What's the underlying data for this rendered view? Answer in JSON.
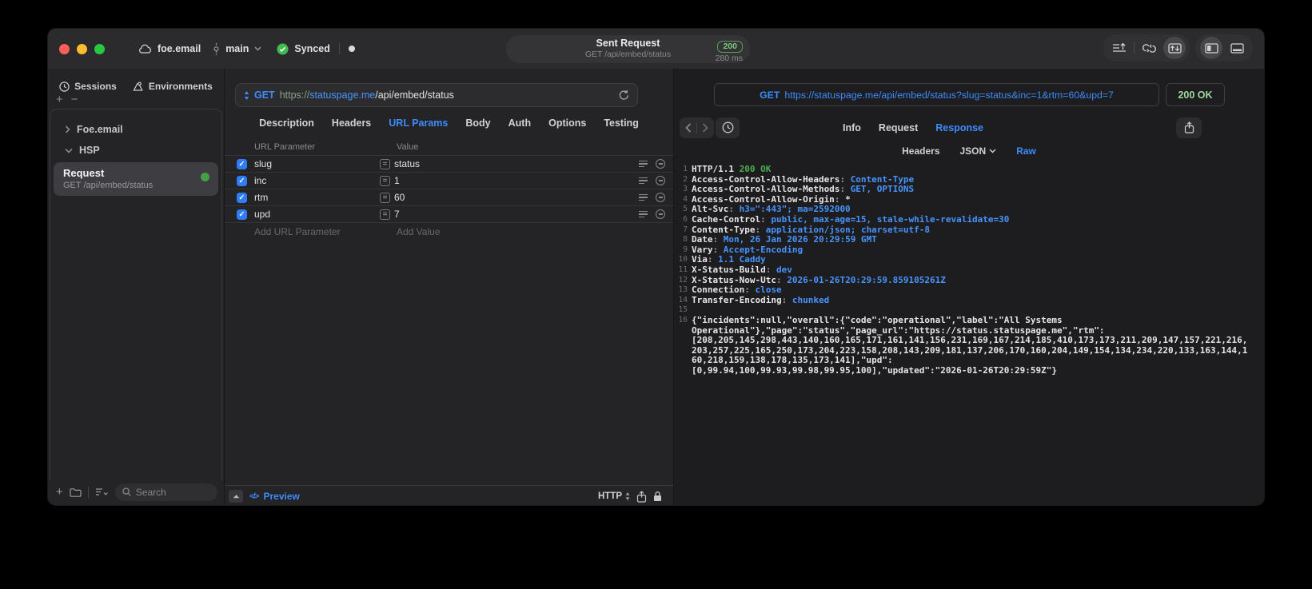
{
  "colors": {
    "accent_blue": "#3d8bfd",
    "url_host_blue": "#4794ff",
    "status_green": "#4cae50",
    "badge_green": "#7ec97e",
    "checkbox_blue": "#2f7cf6",
    "traffic_red": "#ff5f57",
    "traffic_yellow": "#febc2e",
    "traffic_green": "#28c840",
    "request_dot_green": "#43a047"
  },
  "titlebar": {
    "project": "foe.email",
    "branch": "main",
    "sync_status": "Synced",
    "request_title": "Sent Request",
    "request_subtitle": "GET /api/embed/status",
    "status_code": "200",
    "duration": "280 ms"
  },
  "sidebar": {
    "tabs": [
      {
        "label": "Sessions"
      },
      {
        "label": "Environments"
      }
    ],
    "add_label": "+",
    "remove_label": "−",
    "tree": [
      {
        "label": "Foe.email",
        "state": "collapsed"
      },
      {
        "label": "HSP",
        "state": "expanded"
      }
    ],
    "selected_request": {
      "name": "Request",
      "method_path": "GET /api/embed/status"
    },
    "search_placeholder": "Search"
  },
  "request_panel": {
    "method": "GET",
    "url_scheme": "https://",
    "url_host": "statuspage.me",
    "url_path": "/api/embed/status",
    "tabs": [
      "Description",
      "Headers",
      "URL Params",
      "Body",
      "Auth",
      "Options",
      "Testing"
    ],
    "active_tab": "URL Params",
    "param_table": {
      "columns": [
        "URL Parameter",
        "Value"
      ],
      "rows": [
        {
          "name": "slug",
          "value": "status",
          "enabled": true
        },
        {
          "name": "inc",
          "value": "1",
          "enabled": true
        },
        {
          "name": "rtm",
          "value": "60",
          "enabled": true
        },
        {
          "name": "upd",
          "value": "7",
          "enabled": true
        }
      ],
      "add_param_placeholder": "Add URL Parameter",
      "add_value_placeholder": "Add Value"
    },
    "footer": {
      "preview_label": "Preview",
      "code_glyph": "</>",
      "http_label": "HTTP"
    }
  },
  "response_panel": {
    "method": "GET",
    "request_url": "https://statuspage.me/api/embed/status?slug=status&inc=1&rtm=60&upd=7",
    "status": "200 OK",
    "tabs": [
      "Info",
      "Request",
      "Response"
    ],
    "active_tab": "Response",
    "subtabs": [
      {
        "label": "Headers",
        "chevron": false
      },
      {
        "label": "JSON",
        "chevron": true
      },
      {
        "label": "Raw",
        "chevron": false
      }
    ],
    "active_subtab": "Raw",
    "raw_rows": [
      {
        "num": "1",
        "segs": [
          {
            "t": "HTTP/1.1 ",
            "c": "w"
          },
          {
            "t": "200 OK",
            "c": "g"
          }
        ]
      },
      {
        "num": "2",
        "segs": [
          {
            "t": "Access-Control-Allow-Headers",
            "c": "w"
          },
          {
            "t": ": ",
            "c": "p"
          },
          {
            "t": "Content-Type",
            "c": "b"
          }
        ]
      },
      {
        "num": "3",
        "segs": [
          {
            "t": "Access-Control-Allow-Methods",
            "c": "w"
          },
          {
            "t": ": ",
            "c": "p"
          },
          {
            "t": "GET, OPTIONS",
            "c": "b"
          }
        ]
      },
      {
        "num": "4",
        "segs": [
          {
            "t": "Access-Control-Allow-Origin",
            "c": "w"
          },
          {
            "t": ": ",
            "c": "p"
          },
          {
            "t": "*",
            "c": "w"
          }
        ]
      },
      {
        "num": "5",
        "segs": [
          {
            "t": "Alt-Svc",
            "c": "w"
          },
          {
            "t": ": ",
            "c": "p"
          },
          {
            "t": "h3=\":443\"; ma=2592000",
            "c": "b"
          }
        ]
      },
      {
        "num": "6",
        "segs": [
          {
            "t": "Cache-Control",
            "c": "w"
          },
          {
            "t": ": ",
            "c": "p"
          },
          {
            "t": "public, max-age=15, stale-while-revalidate=30",
            "c": "b"
          }
        ]
      },
      {
        "num": "7",
        "segs": [
          {
            "t": "Content-Type",
            "c": "w"
          },
          {
            "t": ": ",
            "c": "p"
          },
          {
            "t": "application/json; charset=utf-8",
            "c": "b"
          }
        ]
      },
      {
        "num": "8",
        "segs": [
          {
            "t": "Date",
            "c": "w"
          },
          {
            "t": ": ",
            "c": "p"
          },
          {
            "t": "Mon, 26 Jan 2026 20:29:59 GMT",
            "c": "b"
          }
        ]
      },
      {
        "num": "9",
        "segs": [
          {
            "t": "Vary",
            "c": "w"
          },
          {
            "t": ": ",
            "c": "p"
          },
          {
            "t": "Accept-Encoding",
            "c": "b"
          }
        ]
      },
      {
        "num": "10",
        "segs": [
          {
            "t": "Via",
            "c": "w"
          },
          {
            "t": ": ",
            "c": "p"
          },
          {
            "t": "1.1 Caddy",
            "c": "b"
          }
        ]
      },
      {
        "num": "11",
        "segs": [
          {
            "t": "X-Status-Build",
            "c": "w"
          },
          {
            "t": ": ",
            "c": "p"
          },
          {
            "t": "dev",
            "c": "b"
          }
        ]
      },
      {
        "num": "12",
        "segs": [
          {
            "t": "X-Status-Now-Utc",
            "c": "w"
          },
          {
            "t": ": ",
            "c": "p"
          },
          {
            "t": "2026-01-26T20:29:59.859105261Z",
            "c": "b"
          }
        ]
      },
      {
        "num": "13",
        "segs": [
          {
            "t": "Connection",
            "c": "w"
          },
          {
            "t": ": ",
            "c": "p"
          },
          {
            "t": "close",
            "c": "b"
          }
        ]
      },
      {
        "num": "14",
        "segs": [
          {
            "t": "Transfer-Encoding",
            "c": "w"
          },
          {
            "t": ": ",
            "c": "p"
          },
          {
            "t": "chunked",
            "c": "b"
          }
        ]
      },
      {
        "num": "15",
        "segs": []
      },
      {
        "num": "16",
        "segs": [
          {
            "t": "{\"incidents\":null,\"overall\":{\"code\":\"operational\",\"label\":\"All Systems",
            "c": "w"
          }
        ]
      },
      {
        "num": "",
        "segs": [
          {
            "t": "Operational\"},\"page\":\"status\",\"page_url\":\"https://status.statuspage.me\",\"rtm\":",
            "c": "w"
          }
        ]
      },
      {
        "num": "",
        "segs": [
          {
            "t": "[208,205,145,298,443,140,160,165,171,161,141,156,231,169,167,214,185,410,173,173,211,209,147,157,221,216,",
            "c": "w"
          }
        ]
      },
      {
        "num": "",
        "segs": [
          {
            "t": "203,257,225,165,250,173,204,223,158,208,143,209,181,137,206,170,160,204,149,154,134,234,220,133,163,144,1",
            "c": "w"
          }
        ]
      },
      {
        "num": "",
        "segs": [
          {
            "t": "60,218,159,138,178,135,173,141],\"upd\":",
            "c": "w"
          }
        ]
      },
      {
        "num": "",
        "segs": [
          {
            "t": "[0,99.94,100,99.93,99.98,99.95,100],\"updated\":\"2026-01-26T20:29:59Z\"}",
            "c": "w"
          }
        ]
      }
    ]
  }
}
